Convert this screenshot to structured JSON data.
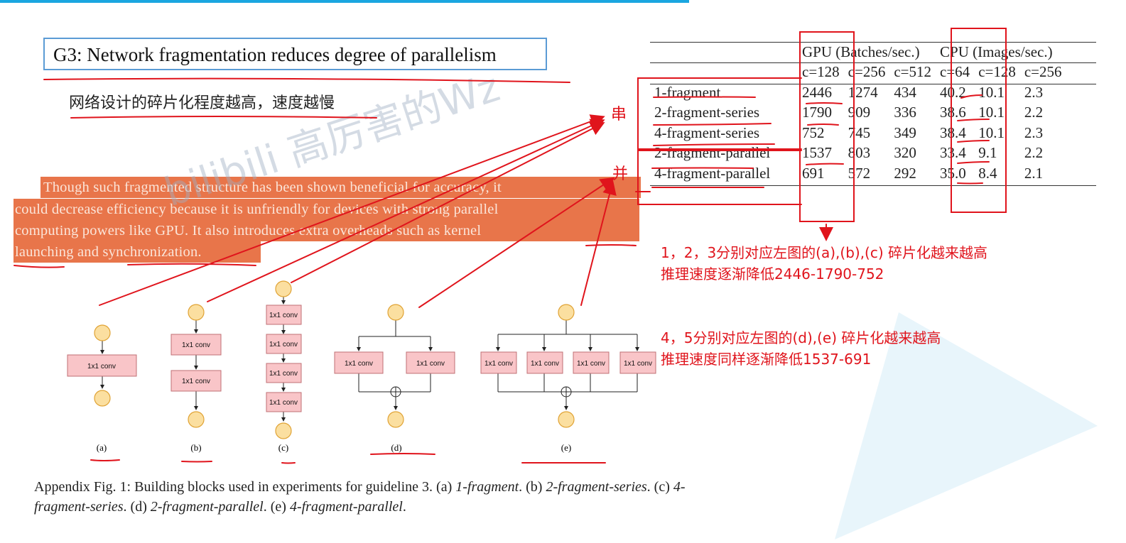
{
  "slide": {
    "title": "G3: Network fragmentation reduces degree of parallelism",
    "subtitle_cn": "网络设计的碎片化程度越高，速度越慢",
    "highlighted_text": [
      "Though such fragmented structure has been shown beneficial for accuracy, it",
      "could decrease efficiency because it is unfriendly for devices with strong parallel",
      "computing powers like GPU. It also introduces extra overheads such as kernel",
      "launching and synchronization."
    ],
    "watermark": "bilibili 高厉害的Wz",
    "label_series": "串",
    "label_parallel": "并",
    "notes": [
      "1，2，3分别对应左图的(a),(b),(c) 碎片化越来越高",
      "推理速度逐渐降低2446-1790-752",
      "4，5分别对应左图的(d),(e) 碎片化越来越高",
      "推理速度同样逐渐降低1537-691"
    ]
  },
  "table": {
    "group_headers": [
      "GPU (Batches/sec.)",
      "CPU (Images/sec.)"
    ],
    "col_headers": [
      "c=128",
      "c=256",
      "c=512",
      "c=64",
      "c=128",
      "c=256"
    ],
    "rows": [
      {
        "name": "1-fragment",
        "values": [
          "2446",
          "1274",
          "434",
          "40.2",
          "10.1",
          "2.3"
        ]
      },
      {
        "name": "2-fragment-series",
        "values": [
          "1790",
          "909",
          "336",
          "38.6",
          "10.1",
          "2.2"
        ]
      },
      {
        "name": "4-fragment-series",
        "values": [
          "752",
          "745",
          "349",
          "38.4",
          "10.1",
          "2.3"
        ]
      },
      {
        "name": "2-fragment-parallel",
        "values": [
          "1537",
          "803",
          "320",
          "33.4",
          "9.1",
          "2.2"
        ]
      },
      {
        "name": "4-fragment-parallel",
        "values": [
          "691",
          "572",
          "292",
          "35.0",
          "8.4",
          "2.1"
        ]
      }
    ]
  },
  "figure": {
    "conv_label": "1x1 conv",
    "sublabels": [
      "(a)",
      "(b)",
      "(c)",
      "(d)",
      "(e)"
    ],
    "caption_prefix": "Appendix Fig. 1: Building blocks used in experiments for guideline 3. (a)",
    "caption_a": "1-fragment",
    "caption_b_prefix": ". (b)",
    "caption_b": "2-fragment-series",
    "caption_c_prefix": ". (c)",
    "caption_c": "4-fragment-series",
    "caption_d_prefix": ". (d)",
    "caption_d": "2-fragment-parallel",
    "caption_e_prefix": ". (e)",
    "caption_e": "4-fragment-parallel",
    "caption_end": "."
  }
}
